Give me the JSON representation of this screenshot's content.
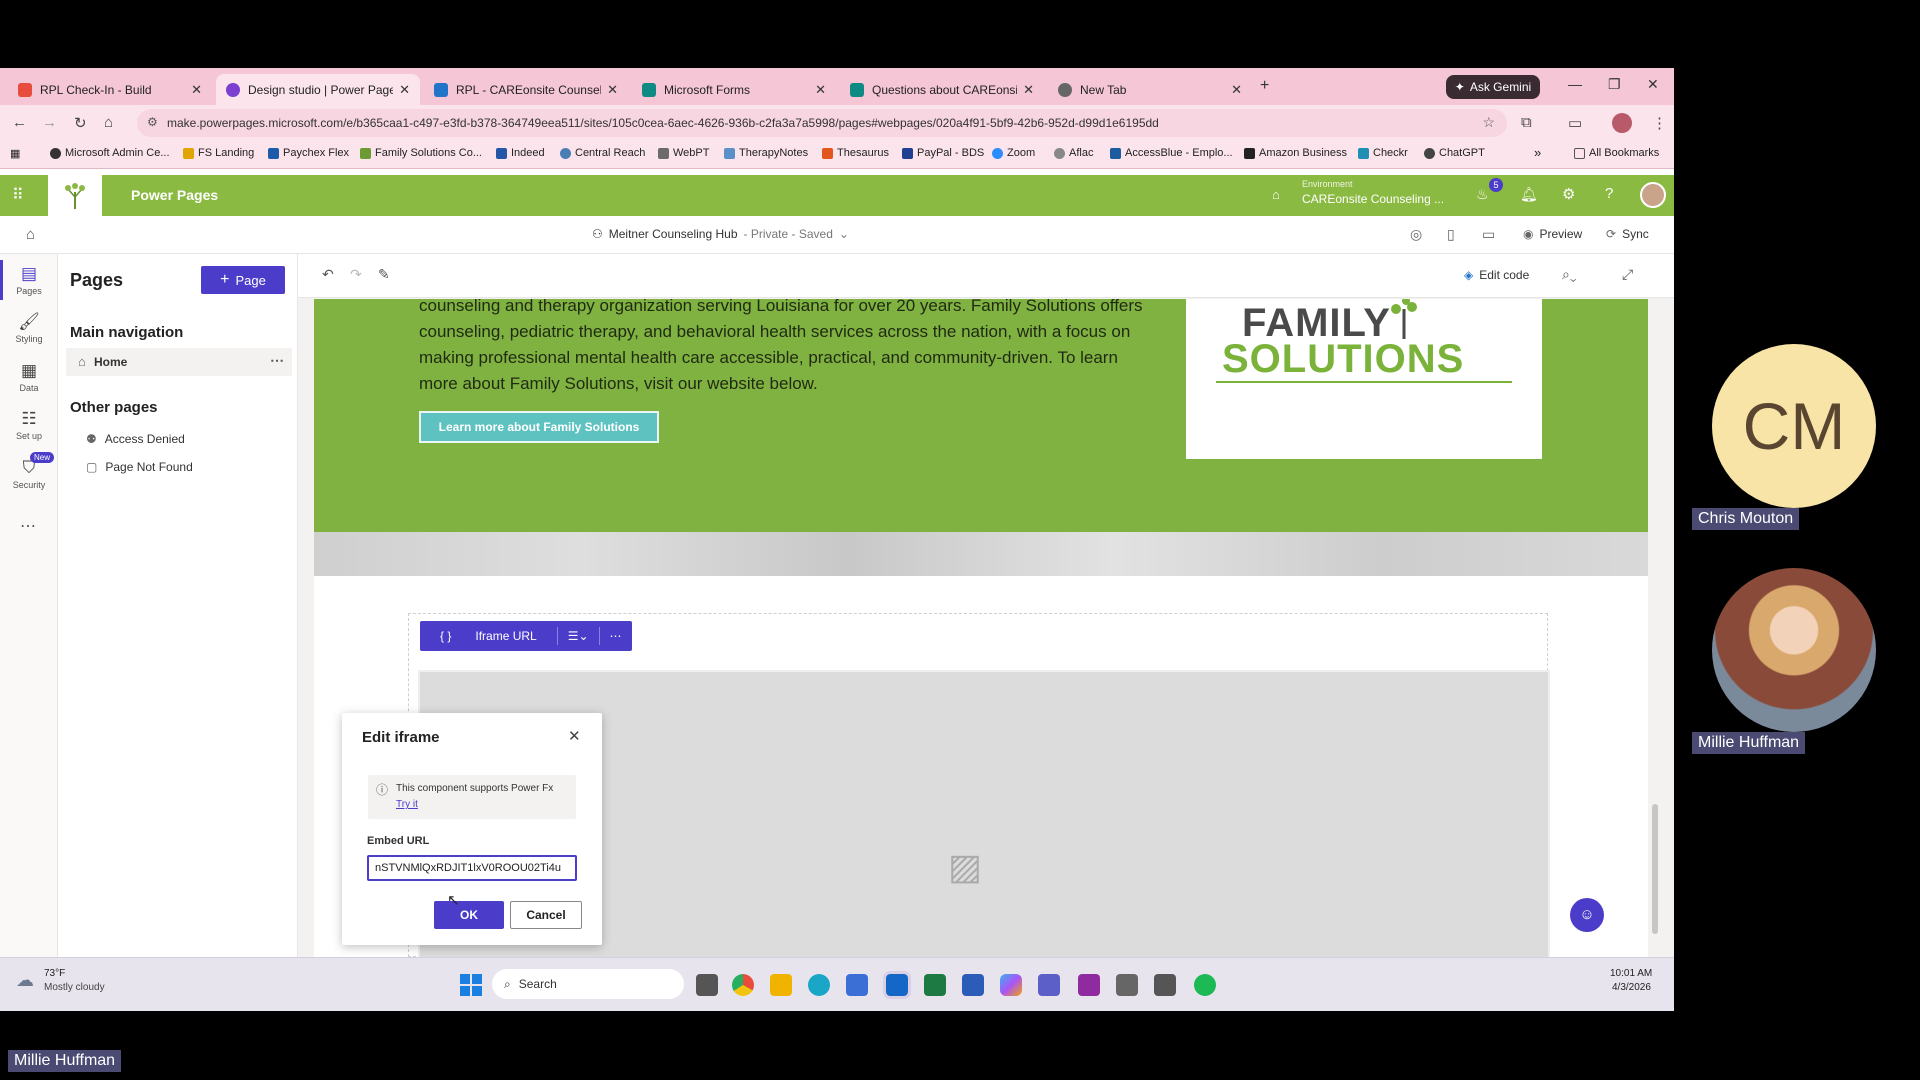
{
  "browser": {
    "tabs": [
      {
        "label": "RPL Check-In - Build",
        "color": "#e74c3c"
      },
      {
        "label": "Design studio | Power Pages",
        "color": "#7b3fd1"
      },
      {
        "label": "RPL - CAREonsite Counseling",
        "color": "#2274c9"
      },
      {
        "label": "Microsoft Forms",
        "color": "#0f8a83"
      },
      {
        "label": "Questions about CAREonsite c",
        "color": "#0f8a83"
      },
      {
        "label": "New Tab",
        "color": "#666666"
      }
    ],
    "new_tab_symbol": "+",
    "ask_gemini": "Ask Gemini",
    "url": "make.powerpages.microsoft.com/e/b365caa1-c497-e3fd-b378-364749eea511/sites/105c0cea-6aec-4626-936b-c2fa3a7a5998/pages#webpages/020a4f91-5bf9-42b6-952d-d99d1e6195dd",
    "bookmarks": [
      "Microsoft Admin Ce...",
      "FS Landing",
      "Paychex Flex",
      "Family Solutions Co...",
      "Indeed",
      "Central Reach",
      "WebPT",
      "TherapyNotes",
      "Thesaurus",
      "PayPal - BDS",
      "Zoom",
      "Aflac",
      "AccessBlue - Emplo...",
      "Amazon Business",
      "Checkr",
      "ChatGPT"
    ],
    "bookmarks_overflow": "»",
    "all_bookmarks": "All Bookmarks"
  },
  "app": {
    "title": "Power Pages",
    "environment_label": "Environment",
    "environment_name": "CAREonsite Counseling ...",
    "notification_count": "5",
    "site_name": "Meitner Counseling Hub",
    "site_status": "- Private - Saved",
    "preview": "Preview",
    "sync": "Sync"
  },
  "rail": [
    {
      "label": "Pages",
      "icon": "pages-icon"
    },
    {
      "label": "Styling",
      "icon": "styling-icon"
    },
    {
      "label": "Data",
      "icon": "data-icon"
    },
    {
      "label": "Set up",
      "icon": "setup-icon"
    },
    {
      "label": "Security",
      "icon": "security-icon",
      "badge": "New"
    }
  ],
  "pages_panel": {
    "title": "Pages",
    "add_button": "Page",
    "main_nav_title": "Main navigation",
    "home": "Home",
    "other_title": "Other pages",
    "access_denied": "Access Denied",
    "page_not_found": "Page Not Found"
  },
  "canvas": {
    "edit_code": "Edit code",
    "intro_text": "counseling and therapy organization serving Louisiana for over 20 years. Family Solutions offers counseling, pediatric therapy, and behavioral health services across the nation, with a focus on making professional mental health care accessible, practical, and community-driven. To learn more about Family Solutions, visit our website below.",
    "learn_button": "Learn more about Family Solutions",
    "logo_line1": "FAMILY",
    "logo_line2": "SOLUTIONS",
    "component_label": "Iframe URL"
  },
  "dialog": {
    "title": "Edit iframe",
    "info_text": "This component supports Power Fx",
    "try_it": "Try it",
    "field_label": "Embed URL",
    "field_value": "nSTVNMlQxRDJIT1lxV0ROOU02Ti4u",
    "ok": "OK",
    "cancel": "Cancel"
  },
  "taskbar": {
    "temperature": "73°F",
    "weather": "Mostly cloudy",
    "search": "Search",
    "time": "10:01 AM",
    "date": "4/3/2026"
  },
  "participants": [
    {
      "name": "Chris Mouton",
      "initials": "CM"
    },
    {
      "name": "Millie Huffman"
    }
  ],
  "active_speaker": "Millie Huffman"
}
